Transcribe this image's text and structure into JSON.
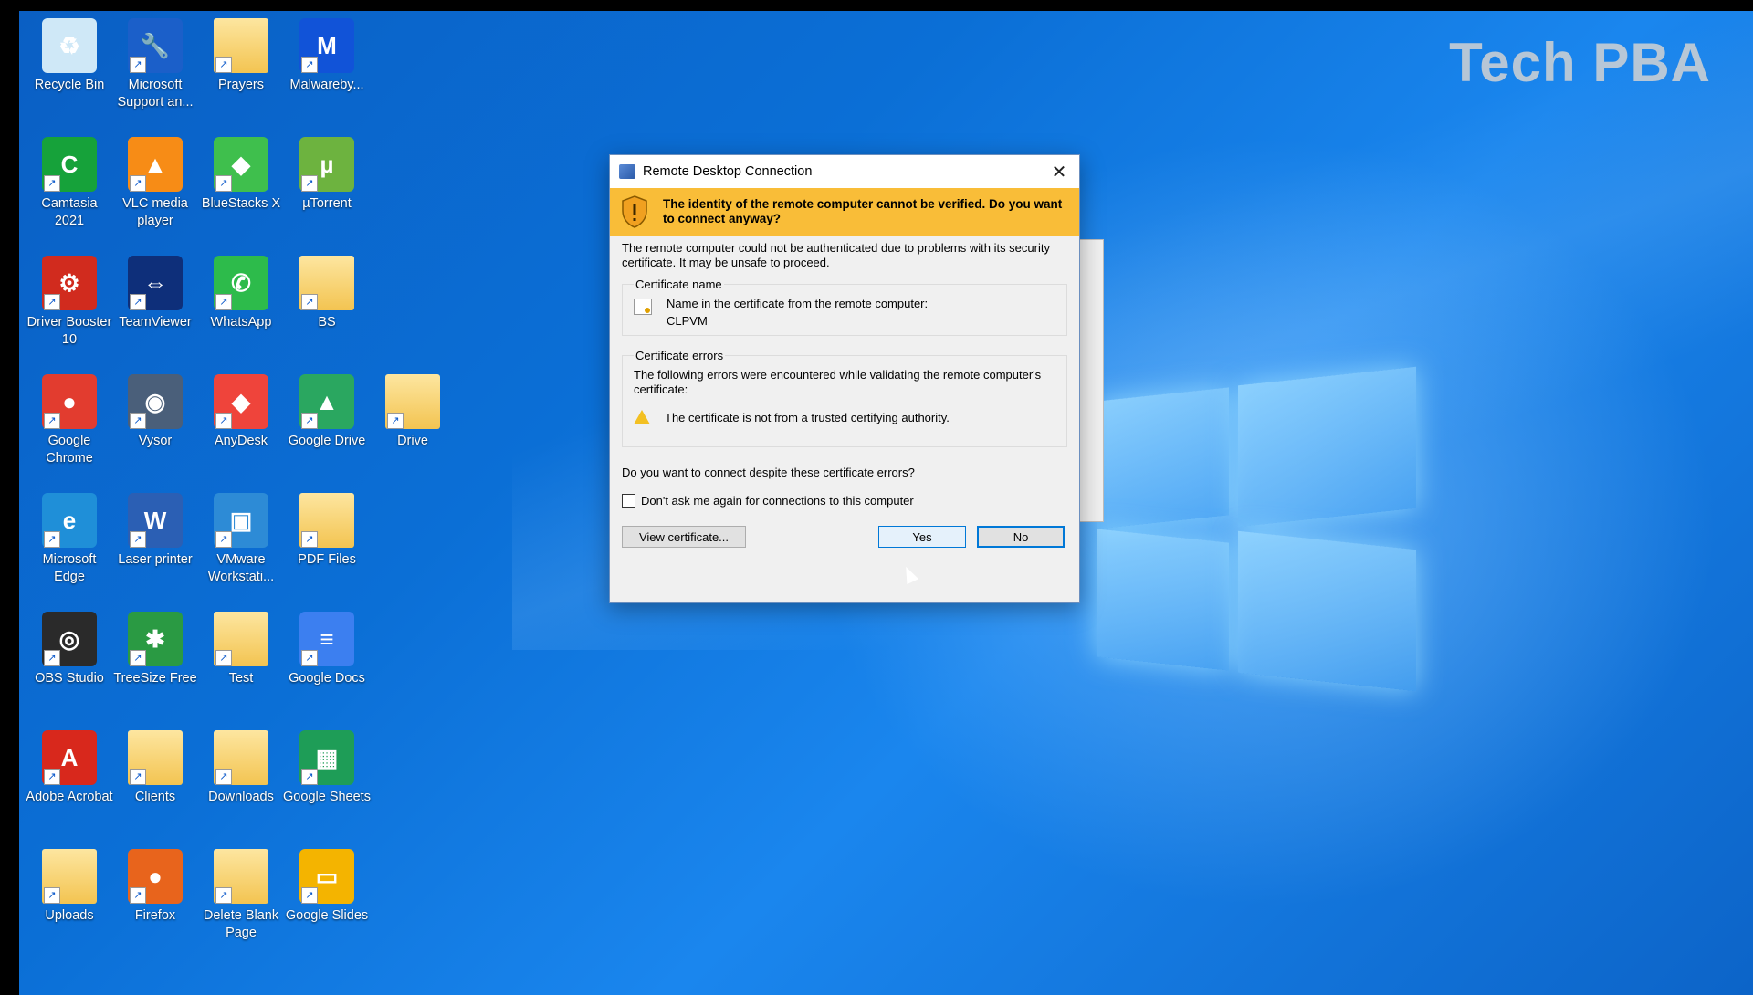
{
  "watermark": "Tech PBA",
  "desktop_icons": [
    {
      "label": "Recycle Bin",
      "icon": "recycle-bin-icon",
      "color": "#cfe8f7",
      "glyph": "♻"
    },
    {
      "label": "Microsoft Support an...",
      "icon": "wrench-icon",
      "color": "#1b5fc9",
      "glyph": "🔧"
    },
    {
      "label": "Prayers",
      "icon": "folder-icon",
      "color": "#f3c451",
      "glyph": ""
    },
    {
      "label": "Malwareby...",
      "icon": "malwarebytes-icon",
      "color": "#1153d8",
      "glyph": "M"
    },
    {
      "label": "Camtasia 2021",
      "icon": "camtasia-icon",
      "color": "#16a23a",
      "glyph": "C"
    },
    {
      "label": "VLC media player",
      "icon": "vlc-icon",
      "color": "#f78c16",
      "glyph": "▲"
    },
    {
      "label": "BlueStacks X",
      "icon": "bluestacks-icon",
      "color": "#3fbf4d",
      "glyph": "◆"
    },
    {
      "label": "µTorrent",
      "icon": "utorrent-icon",
      "color": "#6db33f",
      "glyph": "µ"
    },
    {
      "label": "Driver Booster 10",
      "icon": "driver-booster-icon",
      "color": "#d12b1e",
      "glyph": "⚙"
    },
    {
      "label": "TeamViewer",
      "icon": "teamviewer-icon",
      "color": "#0e2f7a",
      "glyph": "⇔"
    },
    {
      "label": "WhatsApp",
      "icon": "whatsapp-icon",
      "color": "#2dbb4b",
      "glyph": "✆"
    },
    {
      "label": "BS",
      "icon": "folder-icon",
      "color": "#f3c451",
      "glyph": ""
    },
    {
      "label": "Google Chrome",
      "icon": "chrome-icon",
      "color": "#e23c2f",
      "glyph": "●"
    },
    {
      "label": "Vysor",
      "icon": "vysor-icon",
      "color": "#4a5f7a",
      "glyph": "◉"
    },
    {
      "label": "AnyDesk",
      "icon": "anydesk-icon",
      "color": "#ef443b",
      "glyph": "◆"
    },
    {
      "label": "Google Drive",
      "icon": "google-drive-icon",
      "color": "#2aa760",
      "glyph": "▲"
    },
    {
      "label": "Drive",
      "icon": "folder-icon",
      "color": "#f3c451",
      "glyph": ""
    },
    {
      "label": "Microsoft Edge",
      "icon": "edge-icon",
      "color": "#1f8fd8",
      "glyph": "e"
    },
    {
      "label": "Laser printer",
      "icon": "word-icon",
      "color": "#2b5fb4",
      "glyph": "W"
    },
    {
      "label": "VMware Workstati...",
      "icon": "vmware-icon",
      "color": "#2d8bd6",
      "glyph": "▣"
    },
    {
      "label": "PDF Files",
      "icon": "folder-icon",
      "color": "#f3c451",
      "glyph": ""
    },
    {
      "label": "OBS Studio",
      "icon": "obs-icon",
      "color": "#2a2a2a",
      "glyph": "◎"
    },
    {
      "label": "TreeSize Free",
      "icon": "treesize-icon",
      "color": "#2a9a43",
      "glyph": "✱"
    },
    {
      "label": "Test",
      "icon": "folder-icon",
      "color": "#f3c451",
      "glyph": ""
    },
    {
      "label": "Google Docs",
      "icon": "google-docs-icon",
      "color": "#3c7ff0",
      "glyph": "≡"
    },
    {
      "label": "Adobe Acrobat",
      "icon": "acrobat-icon",
      "color": "#d8281c",
      "glyph": "A"
    },
    {
      "label": "Clients",
      "icon": "folder-icon",
      "color": "#f3c451",
      "glyph": ""
    },
    {
      "label": "Downloads",
      "icon": "folder-icon",
      "color": "#f3c451",
      "glyph": ""
    },
    {
      "label": "Google Sheets",
      "icon": "google-sheets-icon",
      "color": "#1e9d57",
      "glyph": "▦"
    },
    {
      "label": "Uploads",
      "icon": "folder-icon",
      "color": "#f3c451",
      "glyph": ""
    },
    {
      "label": "Firefox",
      "icon": "firefox-icon",
      "color": "#e8641c",
      "glyph": "●"
    },
    {
      "label": "Delete Blank Page",
      "icon": "folder-icon",
      "color": "#f3c451",
      "glyph": ""
    },
    {
      "label": "Google Slides",
      "icon": "google-slides-icon",
      "color": "#f4b400",
      "glyph": "▭"
    }
  ],
  "dialog": {
    "title": "Remote Desktop Connection",
    "close_glyph": "✕",
    "warning": "The identity of the remote computer cannot be verified. Do you want to connect anyway?",
    "description": "The remote computer could not be authenticated due to problems with its security certificate. It may be unsafe to proceed.",
    "cert_name_legend": "Certificate name",
    "cert_name_label": "Name in the certificate from the remote computer:",
    "cert_name_value": "CLPVM",
    "cert_errors_legend": "Certificate errors",
    "cert_errors_intro": "The following errors were encountered while validating the remote computer's certificate:",
    "cert_error_1": "The certificate is not from a trusted certifying authority.",
    "question": "Do you want to connect despite these certificate errors?",
    "checkbox_label": "Don't ask me again for connections to this computer",
    "view_certificate": "View certificate...",
    "yes": "Yes",
    "no": "No"
  },
  "colors": {
    "banner": "#f9bd38",
    "accent": "#0078d7",
    "desktop": "#0b6fd6"
  }
}
